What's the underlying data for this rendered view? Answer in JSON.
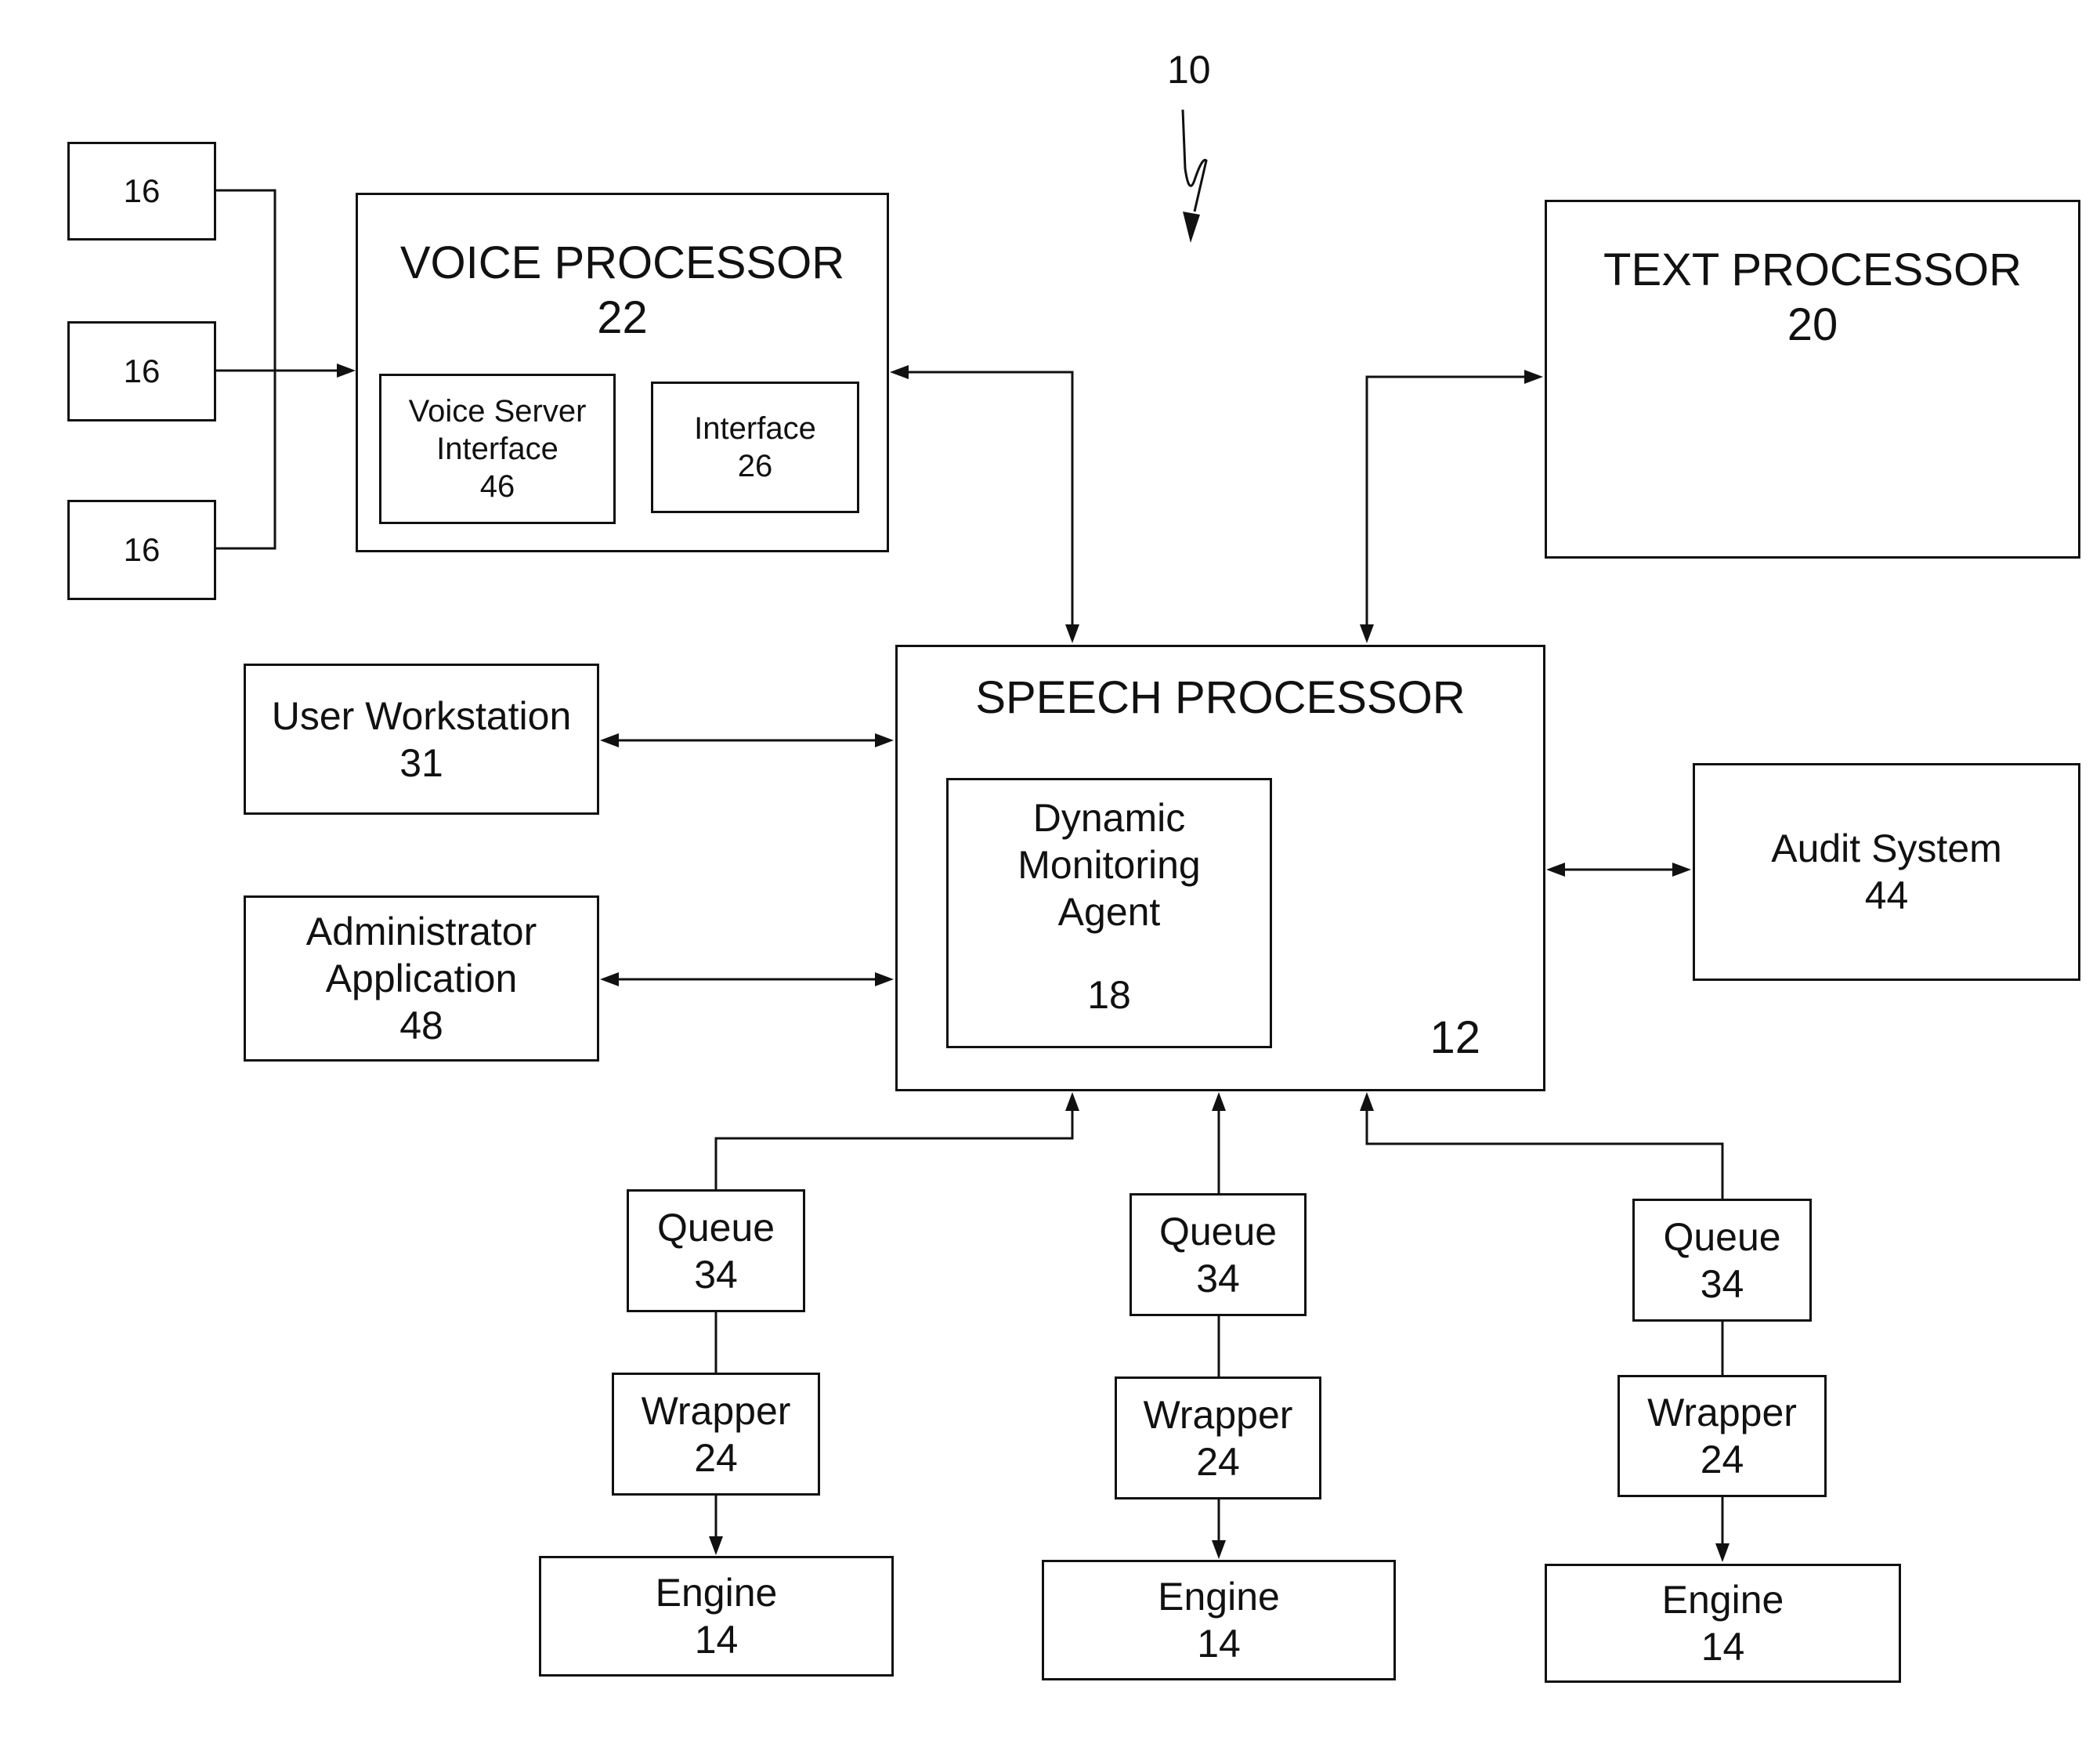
{
  "figure_label": "10",
  "nodes": {
    "terminal_a": {
      "num": "16"
    },
    "terminal_b": {
      "num": "16"
    },
    "terminal_c": {
      "num": "16"
    },
    "voice_processor": {
      "title": "VOICE PROCESSOR",
      "num": "22"
    },
    "voice_server_interface": {
      "line1": "Voice Server",
      "line2": "Interface",
      "num": "46"
    },
    "interface": {
      "title": "Interface",
      "num": "26"
    },
    "text_processor": {
      "title": "TEXT PROCESSOR",
      "num": "20"
    },
    "speech_processor": {
      "title": "SPEECH PROCESSOR",
      "num": "12"
    },
    "dynamic_monitoring_agent": {
      "line1": "Dynamic",
      "line2": "Monitoring",
      "line3": "Agent",
      "num": "18"
    },
    "user_workstation": {
      "title": "User Workstation",
      "num": "31"
    },
    "administrator_application": {
      "line1": "Administrator",
      "line2": "Application",
      "num": "48"
    },
    "audit_system": {
      "title": "Audit System",
      "num": "44"
    },
    "queues": [
      {
        "title": "Queue",
        "num": "34"
      },
      {
        "title": "Queue",
        "num": "34"
      },
      {
        "title": "Queue",
        "num": "34"
      }
    ],
    "wrappers": [
      {
        "title": "Wrapper",
        "num": "24"
      },
      {
        "title": "Wrapper",
        "num": "24"
      },
      {
        "title": "Wrapper",
        "num": "24"
      }
    ],
    "engines": [
      {
        "title": "Engine",
        "num": "14"
      },
      {
        "title": "Engine",
        "num": "14"
      },
      {
        "title": "Engine",
        "num": "14"
      }
    ]
  },
  "connections": [
    {
      "from": "terminal_a",
      "to": "voice_processor",
      "type": "arrow"
    },
    {
      "from": "terminal_b",
      "to": "voice_processor",
      "type": "arrow"
    },
    {
      "from": "terminal_c",
      "to": "voice_processor",
      "type": "arrow"
    },
    {
      "from": "voice_processor",
      "to": "speech_processor",
      "type": "bidirectional"
    },
    {
      "from": "text_processor",
      "to": "speech_processor",
      "type": "bidirectional"
    },
    {
      "from": "user_workstation",
      "to": "speech_processor",
      "type": "bidirectional"
    },
    {
      "from": "administrator_application",
      "to": "speech_processor",
      "type": "bidirectional"
    },
    {
      "from": "audit_system",
      "to": "speech_processor",
      "type": "bidirectional"
    },
    {
      "from": "queue_1",
      "to": "speech_processor",
      "type": "arrow"
    },
    {
      "from": "queue_2",
      "to": "speech_processor",
      "type": "arrow"
    },
    {
      "from": "queue_3",
      "to": "speech_processor",
      "type": "arrow"
    },
    {
      "from": "queue_1",
      "to": "wrapper_1",
      "type": "line"
    },
    {
      "from": "queue_2",
      "to": "wrapper_2",
      "type": "line"
    },
    {
      "from": "queue_3",
      "to": "wrapper_3",
      "type": "line"
    },
    {
      "from": "wrapper_1",
      "to": "engine_1",
      "type": "arrow"
    },
    {
      "from": "wrapper_2",
      "to": "engine_2",
      "type": "arrow"
    },
    {
      "from": "wrapper_3",
      "to": "engine_3",
      "type": "arrow"
    }
  ]
}
